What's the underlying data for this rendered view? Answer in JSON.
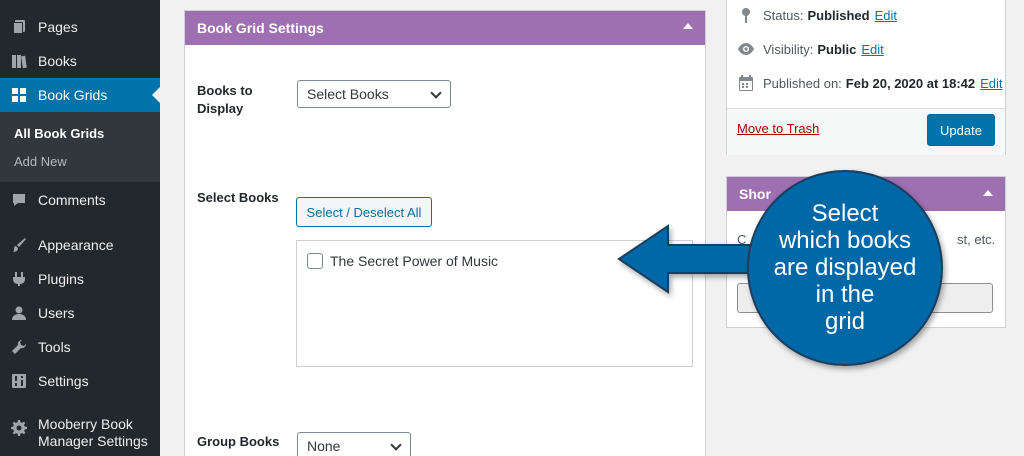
{
  "sidebar": {
    "items": [
      {
        "label": "Pages",
        "icon": "pages-icon"
      },
      {
        "label": "Books",
        "icon": "books-icon"
      },
      {
        "label": "Book Grids",
        "icon": "grid-icon",
        "active": true
      },
      {
        "label": "Comments",
        "icon": "comment-icon"
      },
      {
        "label": "Appearance",
        "icon": "paintbrush-icon"
      },
      {
        "label": "Plugins",
        "icon": "plug-icon"
      },
      {
        "label": "Users",
        "icon": "users-icon"
      },
      {
        "label": "Tools",
        "icon": "wrench-icon"
      },
      {
        "label": "Settings",
        "icon": "settings-icon"
      },
      {
        "label_line1": "Mooberry Book",
        "label_line2": "Manager Settings",
        "icon": "gear-icon"
      }
    ],
    "submenu": [
      {
        "label": "All Book Grids",
        "current": true
      },
      {
        "label": "Add New"
      }
    ]
  },
  "book_grid_settings": {
    "title": "Book Grid Settings",
    "books_to_display_label_line1": "Books to",
    "books_to_display_label_line2": "Display",
    "books_to_display_value": "Select Books",
    "select_books_label": "Select Books",
    "select_deselect_button": "Select / Deselect All",
    "books": [
      "The Secret Power of Music"
    ],
    "group_books_label": "Group Books",
    "group_books_value": "None"
  },
  "publish": {
    "status_label": "Status:",
    "status_value": "Published",
    "visibility_label": "Visibility:",
    "visibility_value": "Public",
    "published_label": "Published on:",
    "published_value": "Feb 20, 2020 at 18:42",
    "edit_label": "Edit",
    "trash_label": "Move to Trash",
    "update_label": "Update"
  },
  "shortcode_box": {
    "title_fragment": "Shor",
    "text_left": "C",
    "text_right": "st, etc."
  },
  "callout": {
    "lines": [
      "Select",
      "which books",
      "are displayed",
      "in the",
      "grid"
    ]
  },
  "colors": {
    "admin_sidebar": "#23282d",
    "active_menu": "#0073aa",
    "metabox_header": "#9e6fb1",
    "callout_blue": "#0067a6"
  }
}
